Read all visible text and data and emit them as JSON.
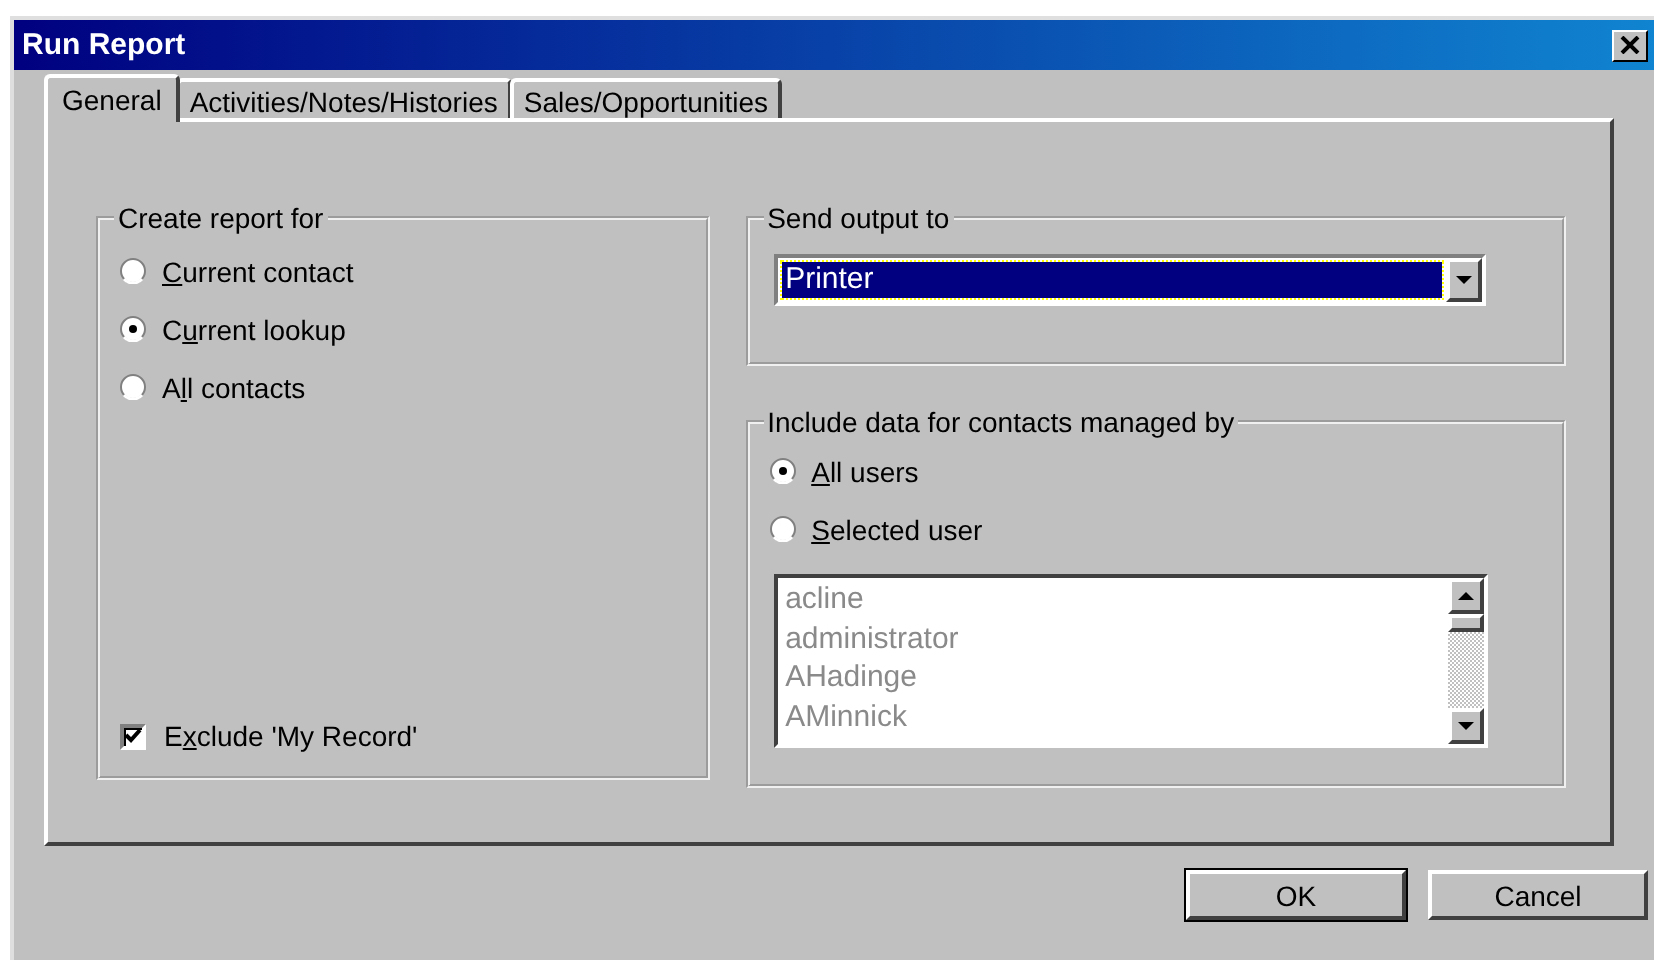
{
  "window": {
    "title": "Run Report"
  },
  "tabs": [
    {
      "label": "General",
      "selected": true
    },
    {
      "label": "Activities/Notes/Histories",
      "selected": false
    },
    {
      "label": "Sales/Opportunities",
      "selected": false
    }
  ],
  "create_report_for": {
    "title": "Create report for",
    "options": [
      {
        "label": {
          "access_key": "C",
          "after": "urrent contact"
        },
        "selected": false
      },
      {
        "label": {
          "before": "C",
          "access_key": "u",
          "after": "rrent lookup"
        },
        "selected": true
      },
      {
        "label": {
          "before": "A",
          "access_key": "l",
          "after": "l contacts"
        },
        "selected": false
      }
    ]
  },
  "exclude_my_record": {
    "label": {
      "before": "E",
      "access_key": "x",
      "after": "clude 'My Record'"
    },
    "checked": true
  },
  "send_output_to": {
    "title": "Send output to",
    "value": "Printer",
    "focused": true
  },
  "include_data": {
    "title": "Include data for contacts managed by",
    "options": [
      {
        "label": {
          "access_key": "A",
          "after": "ll users"
        },
        "selected": true
      },
      {
        "label": {
          "access_key": "S",
          "after": "elected user"
        },
        "selected": false
      }
    ],
    "user_list": {
      "disabled": true,
      "items": [
        "acline",
        "administrator",
        "AHadinge",
        "AMinnick"
      ]
    }
  },
  "buttons": [
    {
      "label": "OK",
      "default": true
    },
    {
      "label": "Cancel",
      "default": false
    }
  ]
}
